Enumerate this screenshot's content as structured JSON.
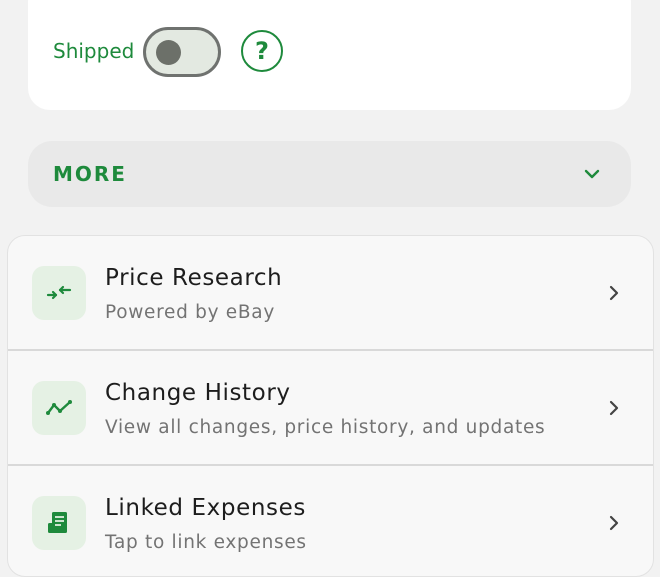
{
  "shipped": {
    "label": "Shipped",
    "toggle_on": false,
    "help_glyph": "?",
    "help_icon": "question-circle-icon"
  },
  "more": {
    "label": "MORE",
    "icon": "chevron-down-icon"
  },
  "list": [
    {
      "title": "Price Research",
      "subtitle": "Powered by eBay",
      "icon": "arrows-compare-icon"
    },
    {
      "title": "Change History",
      "subtitle": "View all changes, price history, and updates",
      "icon": "trend-line-icon"
    },
    {
      "title": "Linked Expenses",
      "subtitle": "Tap to link expenses",
      "icon": "receipt-icon"
    }
  ],
  "colors": {
    "accent": "#1e8a3c",
    "icon_bg": "#e5f1e4",
    "background": "#f2f2f2"
  }
}
